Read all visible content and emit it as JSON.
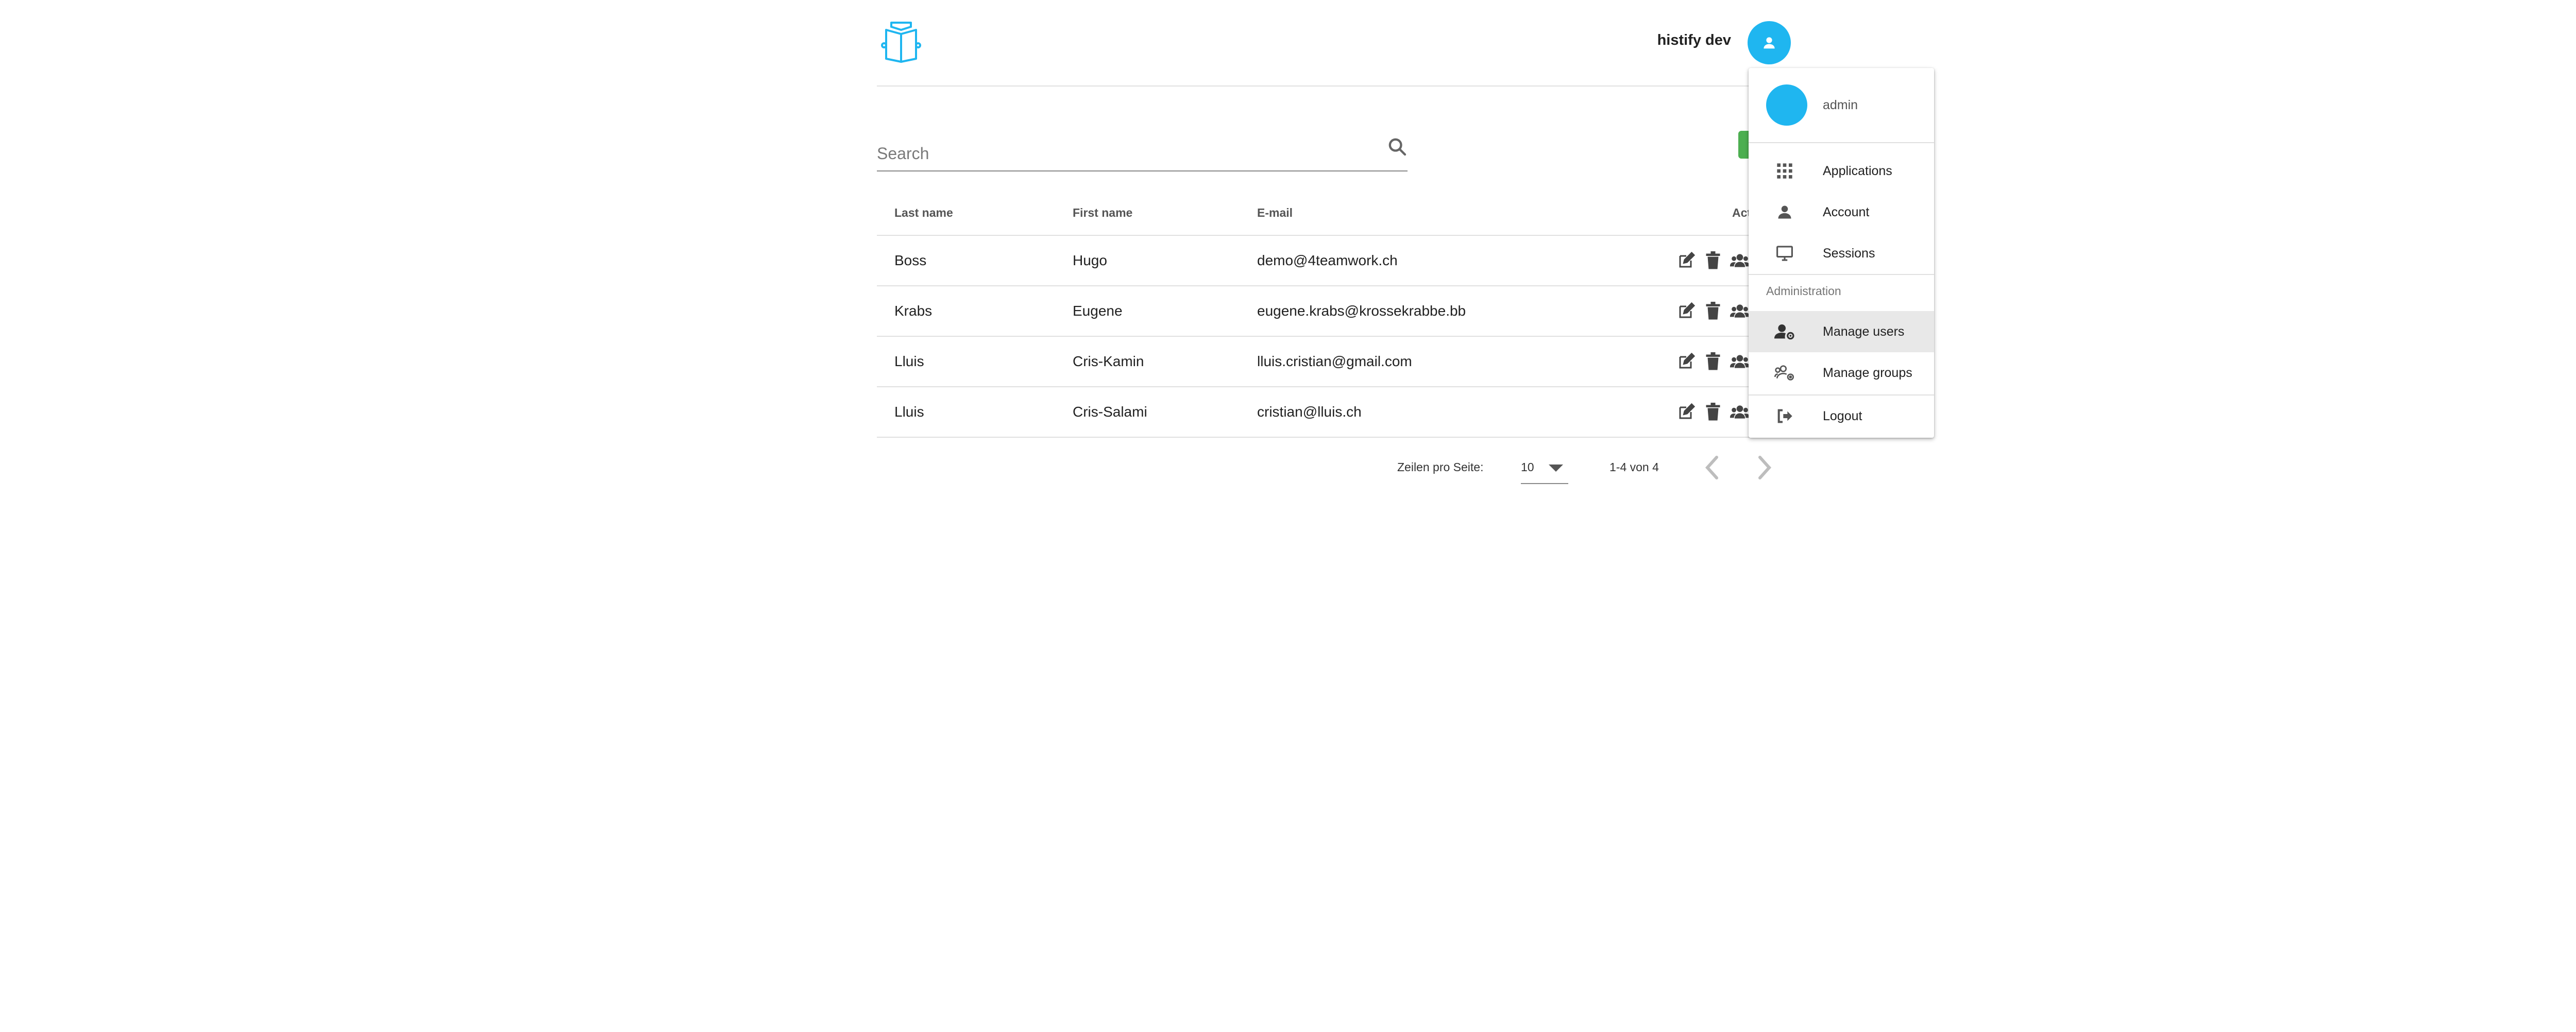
{
  "header": {
    "app_name": "histify dev",
    "logo_icon": "open-book-icon",
    "avatar_icon": "user-icon",
    "brand_color": "#1fb6f0"
  },
  "search": {
    "placeholder": "Search",
    "value": "",
    "icon": "search-icon"
  },
  "table": {
    "columns": [
      "Last name",
      "First name",
      "E-mail",
      "Act"
    ],
    "rows": [
      {
        "last_name": "Boss",
        "first_name": "Hugo",
        "email": "demo@4teamwork.ch"
      },
      {
        "last_name": "Krabs",
        "first_name": "Eugene",
        "email": "eugene.krabs@krossekrabbe.bb"
      },
      {
        "last_name": "Lluis",
        "first_name": "Cris-Kamin",
        "email": "lluis.cristian@gmail.com"
      },
      {
        "last_name": "Lluis",
        "first_name": "Cris-Salami",
        "email": "cristian@lluis.ch"
      }
    ],
    "row_action_icons": [
      "edit-icon",
      "delete-icon",
      "groups-icon"
    ]
  },
  "pagination": {
    "rows_per_page_label": "Zeilen pro Seite:",
    "rows_per_page_value": "10",
    "range_text": "1-4 von 4"
  },
  "menu": {
    "username": "admin",
    "items": [
      {
        "label": "Applications",
        "icon": "apps-grid-icon"
      },
      {
        "label": "Account",
        "icon": "person-icon"
      },
      {
        "label": "Sessions",
        "icon": "monitor-icon"
      }
    ],
    "section_label": "Administration",
    "admin_items": [
      {
        "label": "Manage users",
        "icon": "manage-users-icon",
        "active": true
      },
      {
        "label": "Manage groups",
        "icon": "manage-groups-icon",
        "active": false
      }
    ],
    "logout_label": "Logout",
    "logout_icon": "logout-icon"
  },
  "colors": {
    "add_button": "#4caf50",
    "menu_active_bg": "#e8e8e8"
  }
}
